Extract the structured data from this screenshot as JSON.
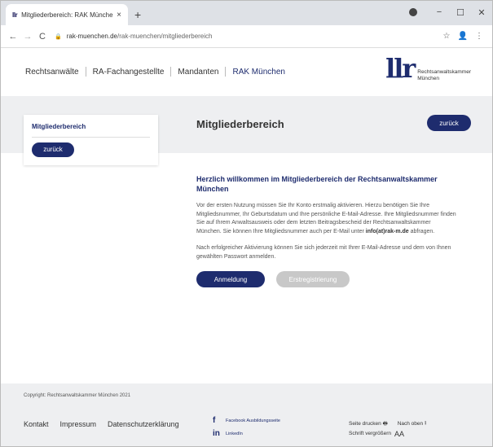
{
  "browser": {
    "tab_favicon": "llr",
    "tab_title": "Mitgliederbereich: RAK München",
    "tab_close": "×",
    "new_tab": "+",
    "win_min": "−",
    "win_max": "☐",
    "win_close": "✕",
    "back": "←",
    "forward": "→",
    "reload": "C",
    "lock": "🔒",
    "url_host": "rak-muenchen.de",
    "url_path": "/rak-muenchen/mitgliederbereich",
    "star": "☆",
    "profile": "👤",
    "menu": "⋮"
  },
  "header": {
    "nav": [
      "Rechtsanwälte",
      "RA-Fachangestellte",
      "Mandanten",
      "RAK München"
    ],
    "logo_mark": "llr",
    "logo_line1": "Rechtsanwaltskammer",
    "logo_line2": "München"
  },
  "sidebar": {
    "title": "Mitgliederbereich",
    "back_label": "zurück"
  },
  "page": {
    "title": "Mitgliederbereich",
    "back_label": "zurück"
  },
  "content": {
    "heading": "Herzlich willkommen im Mitgliederbereich der Rechtsanwaltskammer München",
    "para1": "Vor der ersten Nutzung müssen Sie Ihr Konto erstmalig aktivieren. Hierzu benötigen Sie Ihre Mitgliedsnummer, Ihr Geburtsdatum und Ihre persönliche E-Mail-Adresse. Ihre Mitgliedsnummer finden Sie auf Ihrem Anwaltsausweis oder dem letzten Beitragsbescheid der Rechtsanwaltskammer München. Sie können Ihre Mitgliedsnummer auch per E-Mail unter",
    "email": "info(at)rak-m.de",
    "para1_end": "abfragen.",
    "para2": "Nach erfolgreicher Aktivierung können Sie sich jederzeit mit Ihrer E-Mail-Adresse und dem von Ihnen gewählten Passwort anmelden.",
    "login_label": "Anmeldung",
    "register_label": "Erstregistrierung"
  },
  "footer": {
    "copyright": "Copyright: Rechtsanwaltskammer München 2021",
    "links": [
      "Kontakt",
      "Impressum",
      "Datenschutzerklärung"
    ],
    "facebook_icon": "f",
    "facebook_label": "Facebook Ausbildungsseite",
    "linkedin_icon": "in",
    "linkedin_label": "LinkedIn",
    "print_label": "Seite drucken",
    "print_icon": "🖶",
    "top_label": "Nach oben",
    "top_icon": "⭱",
    "font_label": "Schrift vergrößern",
    "font_icon": "AA"
  }
}
